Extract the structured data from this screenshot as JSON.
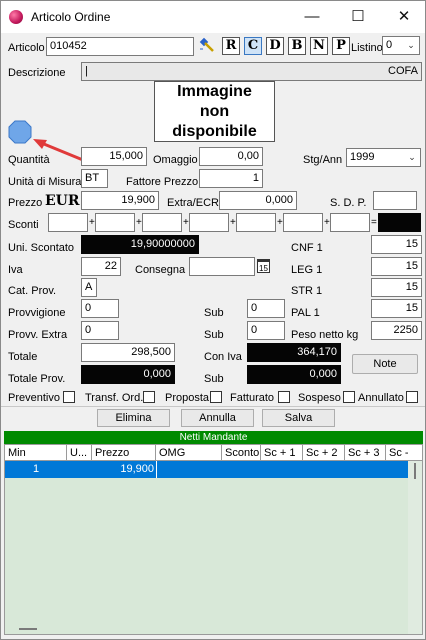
{
  "window": {
    "title": "Articolo Ordine",
    "minimize": "—",
    "maximize": "☐",
    "close": "✕"
  },
  "articolo": {
    "label": "Articolo",
    "value": "010452"
  },
  "format_buttons": [
    "R",
    "C",
    "D",
    "B",
    "N",
    "P"
  ],
  "listino": {
    "label": "Listino",
    "value": "0"
  },
  "descrizione": {
    "label": "Descrizione",
    "value": "COFA"
  },
  "image_placeholder": {
    "line1": "Immagine",
    "line2": "non",
    "line3": "disponibile"
  },
  "quantita": {
    "label": "Quantità",
    "value": "15,000"
  },
  "omaggio": {
    "label": "Omaggio",
    "value": "0,00"
  },
  "stg_ann": {
    "label": "Stg/Ann",
    "value": "1999"
  },
  "unita_misura": {
    "label": "Unità di Misura",
    "value": "BT"
  },
  "fattore_prezzo": {
    "label": "Fattore Prezzo",
    "value": "1"
  },
  "prezzo": {
    "label": "Prezzo",
    "currency": "EUR",
    "value": "19,900"
  },
  "extra_ecr": {
    "label": "Extra/ECR",
    "value": "0,000"
  },
  "sdp": {
    "label": "S. D. P.",
    "value": ""
  },
  "sconti": {
    "label": "Sconti",
    "plus": "+",
    "equals": "="
  },
  "uni_scontato": {
    "label": "Uni. Scontato",
    "value": "19,90000000"
  },
  "cnf": {
    "label": "CNF 1",
    "value": "15"
  },
  "iva": {
    "label": "Iva",
    "value": "22"
  },
  "consegna": {
    "label": "Consegna",
    "value": "",
    "cal_icon": "15"
  },
  "leg": {
    "label": "LEG 1",
    "value": "15"
  },
  "cat_prov": {
    "label": "Cat. Prov.",
    "value": "A"
  },
  "str": {
    "label": "STR 1",
    "value": "15"
  },
  "provvigione": {
    "label": "Provvigione",
    "value": "0"
  },
  "sub1": {
    "label": "Sub",
    "value": "0"
  },
  "pal": {
    "label": "PAL 1",
    "value": "15"
  },
  "provv_extra": {
    "label": "Provv. Extra",
    "value": "0"
  },
  "sub2": {
    "label": "Sub",
    "value": "0"
  },
  "peso_netto": {
    "label": "Peso netto kg",
    "value": "2250"
  },
  "totale": {
    "label": "Totale",
    "value": "298,500"
  },
  "con_iva": {
    "label": "Con Iva",
    "value": "364,170"
  },
  "note_button": "Note",
  "totale_prov": {
    "label": "Totale Prov.",
    "value": "0,000"
  },
  "sub3": {
    "label": "Sub",
    "value": "0,000"
  },
  "checkboxes": [
    "Preventivo",
    "Transf. Ord.",
    "Proposta",
    "Fatturato",
    "Sospeso",
    "Annullato"
  ],
  "actions": {
    "elimina": "Elimina",
    "annulla": "Annulla",
    "salva": "Salva"
  },
  "grid": {
    "banner": "Netti Mandante",
    "columns": [
      "Min",
      "U...",
      "Prezzo",
      "OMG",
      "Sconto",
      "Sc + 1",
      "Sc + 2",
      "Sc + 3",
      "Sc -"
    ],
    "rows": [
      {
        "min": "1",
        "prezzo": "19,900"
      }
    ]
  },
  "colors": {
    "green_banner": "#008a00",
    "selected_row": "#0078d7",
    "grid_bg": "#d8e8d8"
  }
}
